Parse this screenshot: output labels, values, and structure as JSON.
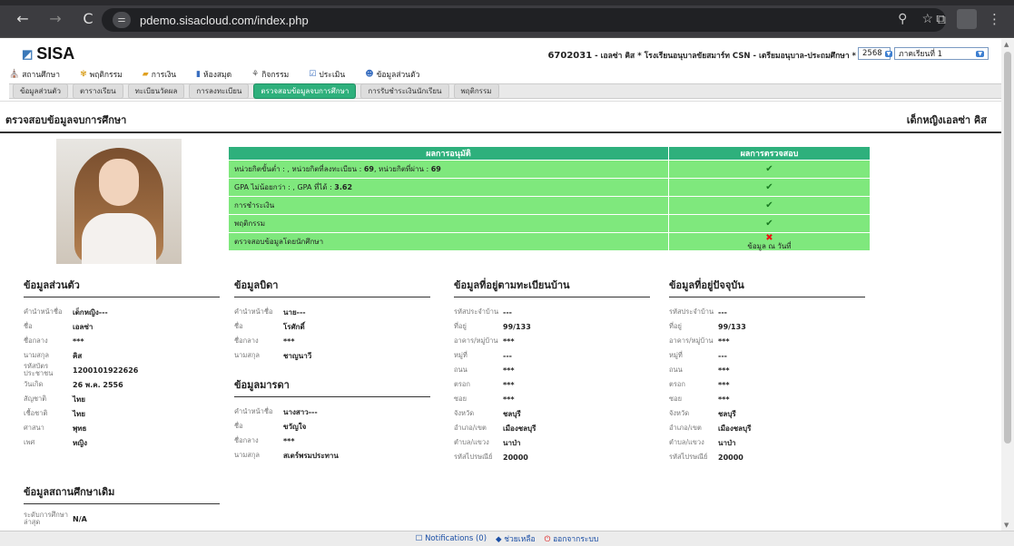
{
  "browser": {
    "url": "pdemo.sisacloud.com/index.php",
    "nav": {
      "back": "←",
      "forward": "→",
      "reload": "C"
    }
  },
  "header": {
    "logo_text": "SISA",
    "school_id": "6702031",
    "school_line": "- เอลซ่า คิส * โรงเรียนอนุบาลขัยสมาร์ท CSN - เตรียมอนุบาล-ประถมศึกษา *",
    "year": "2568",
    "term": "ภาคเรียนที่ 1"
  },
  "main_menu": [
    "สถานศึกษา",
    "พฤติกรรม",
    "การเงิน",
    "ห้องสมุด",
    "กิจกรรม",
    "ประเมิน",
    "ข้อมูลส่วนตัว"
  ],
  "sub_menu": [
    "ข้อมูลส่วนตัว",
    "ตารางเรียน",
    "ทะเบียนวัดผล",
    "การลงทะเบียน",
    "ตรวจสอบข้อมูลจบการศึกษา",
    "การรับชำระเงินนักเรียน",
    "พฤติกรรม"
  ],
  "page": {
    "title": "ตรวจสอบข้อมูลจบการศึกษา",
    "student_name": "เด็กหญิงเอลซ่า คิส"
  },
  "result_table": {
    "headers": [
      "ผลการอนุมัติ",
      "ผลการตรวจสอบ"
    ],
    "rows": [
      {
        "label_a": "หน่วยกิตขั้นต่ำ : , หน่วยกิตที่ลงทะเบียน : ",
        "bold_a": "69",
        "label_b": ", หน่วยกิตที่ผ่าน : ",
        "bold_b": "69",
        "status": "✔"
      },
      {
        "label_a": "GPA ไม่น้อยกว่า : , GPA ที่ได้ : ",
        "bold_a": "3.62",
        "label_b": "",
        "bold_b": "",
        "status": "✔"
      },
      {
        "label_a": "การชำระเงิน",
        "bold_a": "",
        "label_b": "",
        "bold_b": "",
        "status": "✔"
      },
      {
        "label_a": "พฤติกรรม",
        "bold_a": "",
        "label_b": "",
        "bold_b": "",
        "status": "✔"
      },
      {
        "label_a": "ตรวจสอบข้อมูลโดยนักศึกษา",
        "bold_a": "",
        "label_b": "",
        "bold_b": "",
        "status": "✖",
        "note": "ข้อมูล ณ วันที่"
      }
    ]
  },
  "personal": {
    "title": "ข้อมูลส่วนตัว",
    "rows": [
      {
        "k": "คำนำหน้าชื่อ",
        "v": "เด็กหญิง---"
      },
      {
        "k": "ชื่อ",
        "v": "เอลซ่า"
      },
      {
        "k": "ชื่อกลาง",
        "v": "***"
      },
      {
        "k": "นามสกุล",
        "v": "คิส"
      },
      {
        "k": "รหัสบัตรประชาชน",
        "v": "1200101922626"
      },
      {
        "k": "วันเกิด",
        "v": "26 พ.ค. 2556"
      },
      {
        "k": "สัญชาติ",
        "v": "ไทย"
      },
      {
        "k": "เชื้อชาติ",
        "v": "ไทย"
      },
      {
        "k": "ศาสนา",
        "v": "พุทธ"
      },
      {
        "k": "เพศ",
        "v": "หญิง"
      }
    ]
  },
  "prev_school": {
    "title": "ข้อมูลสถานศึกษาเดิม",
    "rows": [
      {
        "k": "ระดับการศึกษาล่าสุด",
        "v": "N/A"
      }
    ]
  },
  "father": {
    "title": "ข้อมูลบิดา",
    "rows": [
      {
        "k": "คำนำหน้าชื่อ",
        "v": "นาย---"
      },
      {
        "k": "ชื่อ",
        "v": "โรศักดิ์"
      },
      {
        "k": "ชื่อกลาง",
        "v": "***"
      },
      {
        "k": "นามสกุล",
        "v": "ชาญนาวี"
      }
    ]
  },
  "mother": {
    "title": "ข้อมูลมารดา",
    "rows": [
      {
        "k": "คำนำหน้าชื่อ",
        "v": "นางสาว---"
      },
      {
        "k": "ชื่อ",
        "v": "ขวัญใจ"
      },
      {
        "k": "ชื่อกลาง",
        "v": "***"
      },
      {
        "k": "นามสกุล",
        "v": "สเตร์พรมประทาน"
      }
    ]
  },
  "registered_address": {
    "title": "ข้อมูลที่อยู่ตามทะเบียนบ้าน",
    "rows": [
      {
        "k": "รหัสประจำบ้าน",
        "v": "---"
      },
      {
        "k": "ที่อยู่",
        "v": "99/133"
      },
      {
        "k": "อาคาร/หมู่บ้าน",
        "v": "***"
      },
      {
        "k": "หมู่ที่",
        "v": "---"
      },
      {
        "k": "ถนน",
        "v": "***"
      },
      {
        "k": "ตรอก",
        "v": "***"
      },
      {
        "k": "ซอย",
        "v": "***"
      },
      {
        "k": "จังหวัด",
        "v": "ชลบุรี"
      },
      {
        "k": "อำเภอ/เขต",
        "v": "เมืองชลบุรี"
      },
      {
        "k": "ตำบล/แขวง",
        "v": "นาป่า"
      },
      {
        "k": "รหัสไปรษณีย์",
        "v": "20000"
      }
    ]
  },
  "current_address": {
    "title": "ข้อมูลที่อยู่ปัจจุบัน",
    "rows": [
      {
        "k": "รหัสประจำบ้าน",
        "v": "---"
      },
      {
        "k": "ที่อยู่",
        "v": "99/133"
      },
      {
        "k": "อาคาร/หมู่บ้าน",
        "v": "***"
      },
      {
        "k": "หมู่ที่",
        "v": "---"
      },
      {
        "k": "ถนน",
        "v": "***"
      },
      {
        "k": "ตรอก",
        "v": "***"
      },
      {
        "k": "ซอย",
        "v": "***"
      },
      {
        "k": "จังหวัด",
        "v": "ชลบุรี"
      },
      {
        "k": "อำเภอ/เขต",
        "v": "เมืองชลบุรี"
      },
      {
        "k": "ตำบล/แขวง",
        "v": "นาป่า"
      },
      {
        "k": "รหัสไปรษณีย์",
        "v": "20000"
      }
    ]
  },
  "footer": {
    "notifications": "Notifications (0)",
    "help": "ช่วยเหลือ",
    "logout": "ออกจากระบบ"
  },
  "colors": {
    "accent": "#2eb07c",
    "row_bg": "#7fe87d"
  }
}
